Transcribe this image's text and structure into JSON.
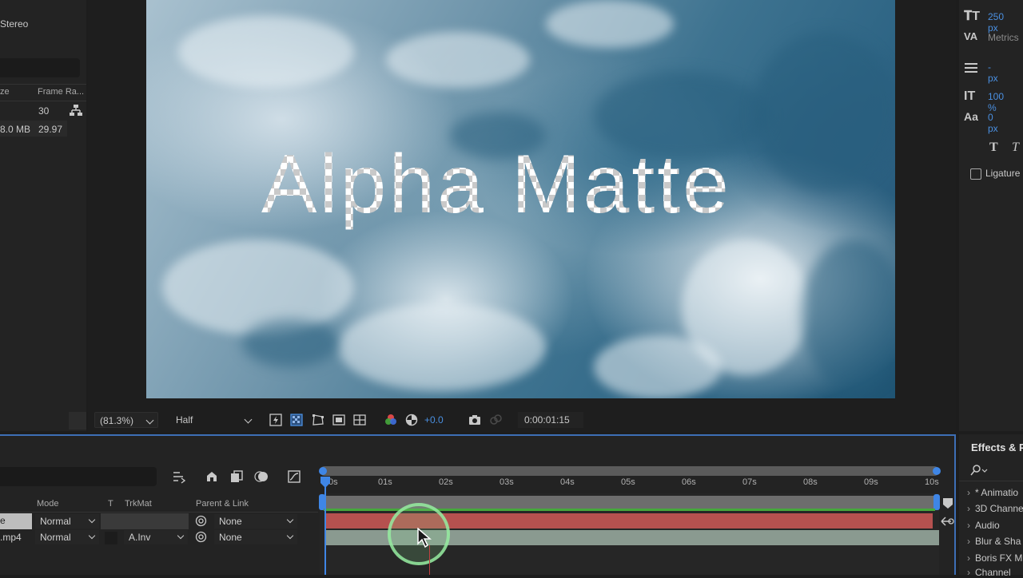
{
  "project_panel": {
    "audio_label": "Stereo",
    "column_size": "ze",
    "column_frame_rate": "Frame Ra...",
    "row1_frame_rate": "30",
    "row2_size": "8.0 MB",
    "row2_frame_rate": "29.97"
  },
  "viewer": {
    "title_text": "Alpha Matte",
    "zoom": "(81.3%)",
    "resolution": "Half",
    "exposure": "+0.0",
    "timecode": "0:00:01:15"
  },
  "character_panel": {
    "font_size": "250 px",
    "tracking_mode": "Metrics",
    "leading": "- px",
    "vertical_scale": "100 %",
    "baseline_shift": "0 px",
    "ligatures_label": "Ligature"
  },
  "timeline": {
    "headers": {
      "mode": "Mode",
      "t": "T",
      "trkmat": "TrkMat",
      "parent": "Parent & Link"
    },
    "layers": [
      {
        "name": "e",
        "mode": "Normal",
        "trkmat": "",
        "parent": "None"
      },
      {
        "name": ".mp4",
        "mode": "Normal",
        "trkmat": "A.Inv",
        "parent": "None"
      }
    ],
    "ruler_ticks": [
      "0s",
      "01s",
      "02s",
      "03s",
      "04s",
      "05s",
      "06s",
      "07s",
      "08s",
      "09s",
      "10s"
    ]
  },
  "effects_panel": {
    "title": "Effects & P",
    "items": [
      "* Animatio",
      "3D Channe",
      "Audio",
      "Blur & Sha",
      "Boris FX M",
      "Channel"
    ]
  },
  "colors": {
    "accent_blue": "#4a8fe0",
    "track_red": "#b5514f",
    "track_green": "#46a83c",
    "panel_border": "#3d6fb6"
  }
}
